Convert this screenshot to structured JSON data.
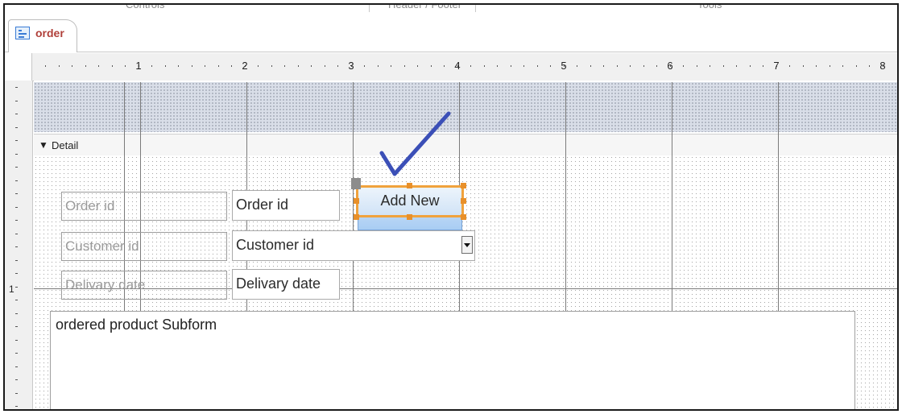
{
  "window": {
    "ribbon_groups": [
      "Controls",
      "Header / Footer",
      "Tools"
    ]
  },
  "document_tab": {
    "label": "order",
    "icon": "form-icon"
  },
  "ruler": {
    "horizontal_numbers": [
      "1",
      "2",
      "3",
      "4",
      "5",
      "6",
      "7",
      "8"
    ],
    "vertical_numbers": [
      "1"
    ]
  },
  "sections": {
    "detail_label": "Detail"
  },
  "form_controls": {
    "order_id": {
      "label": "Order id",
      "value": "Order id"
    },
    "customer_id": {
      "label": "Customer id",
      "value": "Customer id"
    },
    "delivary_date": {
      "label": "Delivary date",
      "value": "Delivary date"
    },
    "add_new_button": "Add New",
    "subform_label": "ordered product Subform"
  },
  "colors": {
    "selection": "#f0a23c",
    "annotation": "#3b4fb7",
    "tab_label": "#b0403a"
  }
}
